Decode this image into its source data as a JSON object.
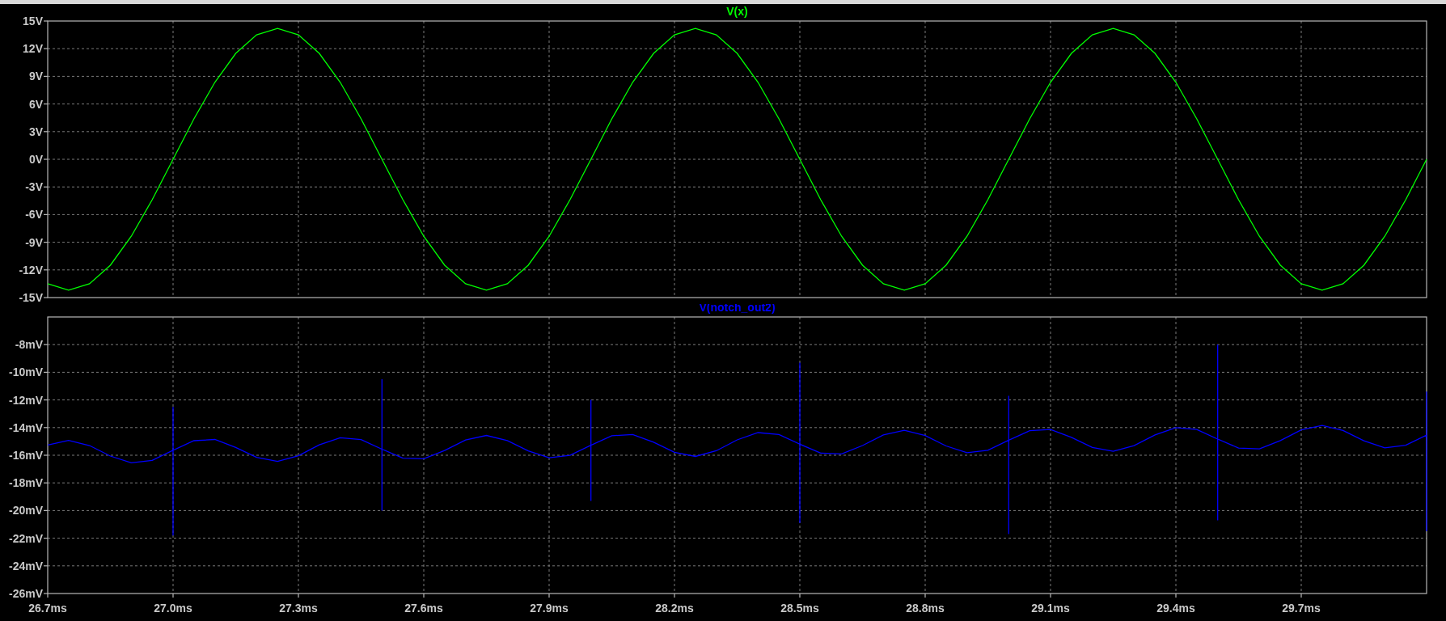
{
  "panes": [
    {
      "chart_data": {
        "type": "line",
        "grid": true,
        "xlim": [
          26.7,
          30.0
        ],
        "ylim": [
          -15,
          15
        ],
        "yticks": [
          {
            "value": 15,
            "label": "15V"
          },
          {
            "value": 12,
            "label": "12V"
          },
          {
            "value": 9,
            "label": "9V"
          },
          {
            "value": 6,
            "label": "6V"
          },
          {
            "value": 3,
            "label": "3V"
          },
          {
            "value": 0,
            "label": "0V"
          },
          {
            "value": -3,
            "label": "-3V"
          },
          {
            "value": -6,
            "label": "-6V"
          },
          {
            "value": -9,
            "label": "-9V"
          },
          {
            "value": -12,
            "label": "-12V"
          },
          {
            "value": -15,
            "label": "-15V"
          }
        ],
        "x": [
          26.7,
          26.75,
          26.8,
          26.85,
          26.9,
          26.95,
          27.0,
          27.05,
          27.1,
          27.15,
          27.2,
          27.25,
          27.3,
          27.35,
          27.4,
          27.45,
          27.5,
          27.55,
          27.6,
          27.65,
          27.7,
          27.75,
          27.8,
          27.85,
          27.9,
          27.95,
          28.0,
          28.05,
          28.1,
          28.15,
          28.2,
          28.25,
          28.3,
          28.35,
          28.4,
          28.45,
          28.5,
          28.55,
          28.6,
          28.65,
          28.7,
          28.75,
          28.8,
          28.85,
          28.9,
          28.95,
          29.0,
          29.05,
          29.1,
          29.15,
          29.2,
          29.25,
          29.3,
          29.35,
          29.4,
          29.45,
          29.5,
          29.55,
          29.6,
          29.65,
          29.7,
          29.75,
          29.8,
          29.85,
          29.9,
          29.95,
          30.0
        ],
        "series": [
          {
            "name": "V(x)",
            "color": "#00ff00",
            "values": [
              -13.5,
              -14.2,
              -13.5,
              -11.49,
              -8.35,
              -4.39,
              0,
              4.39,
              8.35,
              11.49,
              13.5,
              14.2,
              13.5,
              11.49,
              8.35,
              4.39,
              0,
              -4.39,
              -8.35,
              -11.49,
              -13.5,
              -14.2,
              -13.5,
              -11.49,
              -8.35,
              -4.39,
              0,
              4.39,
              8.35,
              11.49,
              13.5,
              14.2,
              13.5,
              11.49,
              8.35,
              4.39,
              0,
              -4.39,
              -8.35,
              -11.49,
              -13.5,
              -14.2,
              -13.5,
              -11.49,
              -8.35,
              -4.39,
              0,
              4.39,
              8.35,
              11.49,
              13.5,
              14.2,
              13.5,
              11.49,
              8.35,
              4.39,
              0,
              -4.39,
              -8.35,
              -11.49,
              -13.5,
              -14.2,
              -13.5,
              -11.49,
              -8.35,
              -4.39,
              0
            ]
          }
        ]
      }
    },
    {
      "chart_data": {
        "type": "line",
        "grid": true,
        "xlim": [
          26.7,
          30.0
        ],
        "ylim": [
          -26,
          -6
        ],
        "xticks": [
          {
            "value": 26.7,
            "label": "26.7ms"
          },
          {
            "value": 27.0,
            "label": "27.0ms"
          },
          {
            "value": 27.3,
            "label": "27.3ms"
          },
          {
            "value": 27.6,
            "label": "27.6ms"
          },
          {
            "value": 27.9,
            "label": "27.9ms"
          },
          {
            "value": 28.2,
            "label": "28.2ms"
          },
          {
            "value": 28.5,
            "label": "28.5ms"
          },
          {
            "value": 28.8,
            "label": "28.8ms"
          },
          {
            "value": 29.1,
            "label": "29.1ms"
          },
          {
            "value": 29.4,
            "label": "29.4ms"
          },
          {
            "value": 29.7,
            "label": "29.7ms"
          }
        ],
        "yticks": [
          {
            "value": -8,
            "label": "-8mV"
          },
          {
            "value": -10,
            "label": "-10mV"
          },
          {
            "value": -12,
            "label": "-12mV"
          },
          {
            "value": -14,
            "label": "-14mV"
          },
          {
            "value": -16,
            "label": "-16mV"
          },
          {
            "value": -18,
            "label": "-18mV"
          },
          {
            "value": -20,
            "label": "-20mV"
          },
          {
            "value": -22,
            "label": "-22mV"
          },
          {
            "value": -24,
            "label": "-24mV"
          },
          {
            "value": -26,
            "label": "-26mV"
          }
        ],
        "x": [
          26.7,
          26.75,
          26.8,
          26.85,
          26.9,
          26.95,
          27.0,
          27.0,
          27.0,
          27.0,
          27.05,
          27.1,
          27.15,
          27.2,
          27.25,
          27.3,
          27.35,
          27.4,
          27.45,
          27.5,
          27.5,
          27.5,
          27.5,
          27.55,
          27.6,
          27.65,
          27.7,
          27.75,
          27.8,
          27.85,
          27.9,
          27.95,
          28.0,
          28.0,
          28.0,
          28.0,
          28.05,
          28.1,
          28.15,
          28.2,
          28.25,
          28.3,
          28.35,
          28.4,
          28.45,
          28.5,
          28.5,
          28.5,
          28.5,
          28.55,
          28.6,
          28.65,
          28.7,
          28.75,
          28.8,
          28.85,
          28.9,
          28.95,
          29.0,
          29.0,
          29.0,
          29.0,
          29.05,
          29.1,
          29.15,
          29.2,
          29.25,
          29.3,
          29.35,
          29.4,
          29.45,
          29.5,
          29.5,
          29.5,
          29.5,
          29.55,
          29.6,
          29.65,
          29.7,
          29.75,
          29.8,
          29.85,
          29.9,
          29.95,
          30.0,
          30.0,
          30.0
        ],
        "series": [
          {
            "name": "V(notch_out2)",
            "color": "#0000ff",
            "values": [
              -15.26,
              -14.93,
              -15.3,
              -16.06,
              -16.55,
              -16.37,
              -15.64,
              -12.5,
              -21.8,
              -15.64,
              -14.95,
              -14.86,
              -15.43,
              -16.16,
              -16.45,
              -16.04,
              -15.25,
              -14.73,
              -14.87,
              -15.56,
              -10.5,
              -20.0,
              -15.56,
              -16.21,
              -16.26,
              -15.66,
              -14.9,
              -14.57,
              -14.94,
              -15.69,
              -16.18,
              -16.01,
              -15.28,
              -12.0,
              -19.3,
              -15.28,
              -14.59,
              -14.5,
              -15.06,
              -15.79,
              -16.09,
              -15.68,
              -14.89,
              -14.36,
              -14.5,
              -15.2,
              -9.3,
              -20.9,
              -15.2,
              -15.85,
              -15.9,
              -15.3,
              -14.53,
              -14.2,
              -14.58,
              -15.33,
              -15.82,
              -15.64,
              -14.91,
              -11.7,
              -21.7,
              -14.91,
              -14.23,
              -14.14,
              -14.7,
              -15.43,
              -15.72,
              -15.31,
              -14.53,
              -14.0,
              -14.14,
              -14.83,
              -8.0,
              -20.7,
              -14.83,
              -15.48,
              -15.54,
              -14.94,
              -14.17,
              -13.84,
              -14.21,
              -14.96,
              -15.46,
              -15.28,
              -14.55,
              -11.4,
              -21.5
            ]
          }
        ]
      }
    }
  ]
}
